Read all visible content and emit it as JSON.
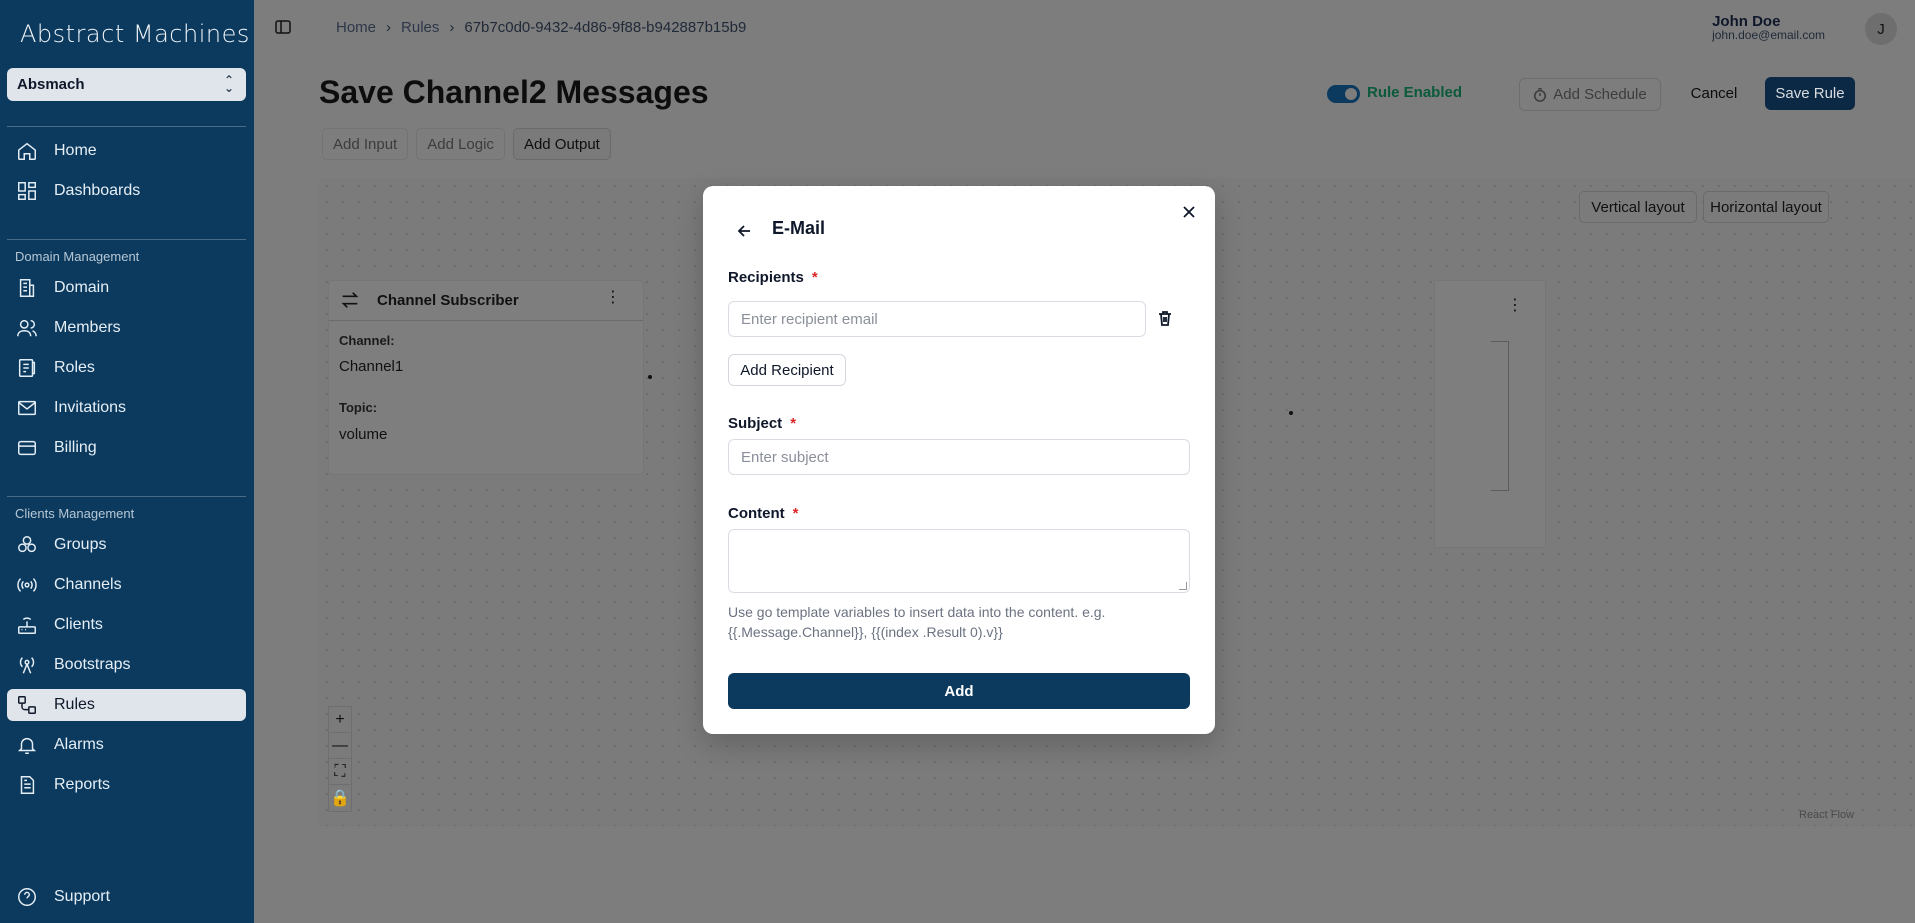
{
  "app": {
    "logo": "Abstract Machines",
    "domain_selector": "Absmach"
  },
  "sidebar": {
    "items": [
      {
        "label": "Home",
        "icon": "home-icon"
      },
      {
        "label": "Dashboards",
        "icon": "dashboard-icon"
      }
    ],
    "domain_section": "Domain Management",
    "domain_items": [
      {
        "label": "Domain",
        "icon": "building-icon"
      },
      {
        "label": "Members",
        "icon": "users-icon"
      },
      {
        "label": "Roles",
        "icon": "roles-icon"
      },
      {
        "label": "Invitations",
        "icon": "mail-icon"
      },
      {
        "label": "Billing",
        "icon": "card-icon"
      }
    ],
    "clients_section": "Clients Management",
    "clients_items": [
      {
        "label": "Groups",
        "icon": "groups-icon"
      },
      {
        "label": "Channels",
        "icon": "broadcast-icon"
      },
      {
        "label": "Clients",
        "icon": "router-icon"
      },
      {
        "label": "Bootstraps",
        "icon": "antenna-icon"
      },
      {
        "label": "Rules",
        "icon": "workflow-icon",
        "active": true
      },
      {
        "label": "Alarms",
        "icon": "bell-icon"
      },
      {
        "label": "Reports",
        "icon": "file-icon"
      }
    ],
    "support": "Support"
  },
  "header": {
    "breadcrumb": [
      "Home",
      "Rules",
      "67b7c0d0-9432-4d86-9f88-b942887b15b9"
    ],
    "user_name": "John Doe",
    "user_email": "john.doe@email.com",
    "avatar_initial": "J"
  },
  "page": {
    "title": "Save Channel2 Messages",
    "rule_enabled_label": "Rule Enabled",
    "add_schedule": "Add Schedule",
    "cancel": "Cancel",
    "save_rule": "Save Rule",
    "tabs": [
      "Add Input",
      "Add Logic",
      "Add Output"
    ],
    "active_tab": "Add Output"
  },
  "canvas": {
    "vertical_layout": "Vertical layout",
    "horizontal_layout": "Horizontal layout",
    "node": {
      "title": "Channel Subscriber",
      "channel_label": "Channel:",
      "channel_value": "Channel1",
      "topic_label": "Topic:",
      "topic_value": "volume"
    },
    "zoom_controls": [
      "+",
      "—",
      "⛶",
      "🔒"
    ],
    "attribution": "React Flow"
  },
  "modal": {
    "title": "E-Mail",
    "recipients_label": "Recipients",
    "recipient_placeholder": "Enter recipient email",
    "add_recipient": "Add Recipient",
    "subject_label": "Subject",
    "subject_placeholder": "Enter subject",
    "content_label": "Content",
    "required_mark": "*",
    "hint": "Use go template variables to insert data into the content. e.g. {{.Message.Channel}}, {{(index .Result 0).v}}",
    "add_button": "Add"
  },
  "colors": {
    "sidebar": "#0b3a5e",
    "primary": "#0b3a5e",
    "required": "#dc2626",
    "enabled": "#0a5a3b"
  }
}
